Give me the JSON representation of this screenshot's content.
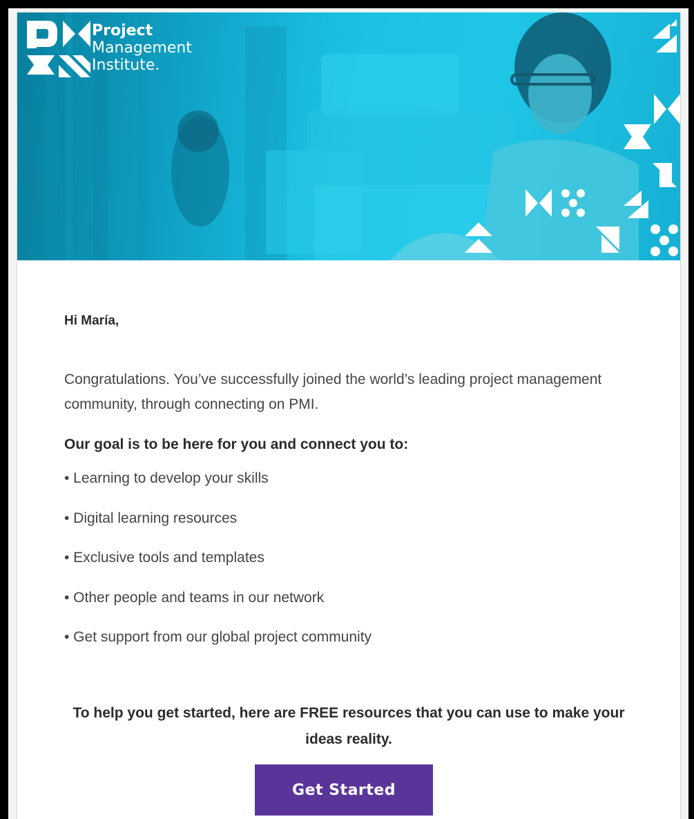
{
  "header": {
    "logo_line1": "Project",
    "logo_line2": "Management",
    "logo_line3": "Institute."
  },
  "email": {
    "greeting": "Hi María,",
    "intro": "Congratulations. You’ve successfully joined the world’s leading project management community, through connecting on PMI.",
    "goal_heading": "Our goal is to be here for you and connect you to:",
    "list_items": [
      "• Learning to develop your skills",
      "• Digital learning resources",
      "• Exclusive tools and templates",
      "• Other people and teams in our network",
      "• Get support from our global project community"
    ],
    "cta_text": "To help you get started, here are FREE resources that you can use to make your ideas reality.",
    "cta_button": "Get Started"
  },
  "colors": {
    "hero": "#1cc2e2",
    "button": "#5a3599"
  }
}
